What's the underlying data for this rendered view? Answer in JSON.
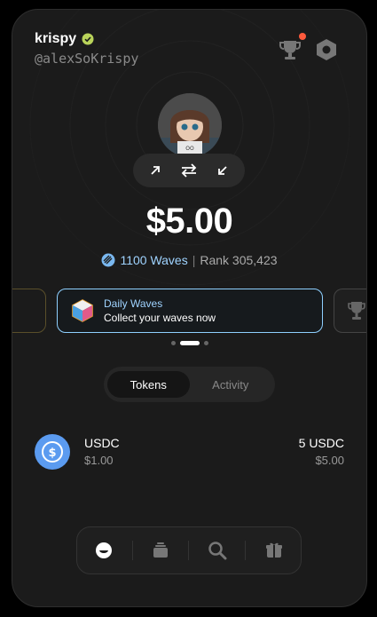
{
  "profile": {
    "username": "krispy",
    "handle": "@alexSoKrispy"
  },
  "balance": {
    "amount": "$5.00",
    "waves": "1100 Waves",
    "separator": "|",
    "rank": "Rank 305,423"
  },
  "carousel": {
    "title": "Daily Waves",
    "subtitle": "Collect your waves now",
    "active_index": 1,
    "count": 3
  },
  "tabs": [
    {
      "label": "Tokens",
      "active": true
    },
    {
      "label": "Activity",
      "active": false
    }
  ],
  "tokens": [
    {
      "name": "USDC",
      "price": "$1.00",
      "amount": "5 USDC",
      "value": "$5.00"
    }
  ],
  "icons": {
    "verified": "verified-badge-icon",
    "trophy": "trophy-icon",
    "settings": "settings-hex-icon",
    "send": "arrow-up-right-icon",
    "swap": "swap-arrows-icon",
    "receive": "arrow-down-left-icon",
    "waves": "waves-icon",
    "daily": "cube-icon",
    "usdc": "usdc-icon",
    "nav": [
      "smile-icon",
      "stack-icon",
      "search-icon",
      "gift-icon"
    ]
  },
  "colors": {
    "accent": "#9fd3ff",
    "notification": "#ff5a3c",
    "usdc": "#5b9bf0",
    "verified": "#b9d35a"
  }
}
